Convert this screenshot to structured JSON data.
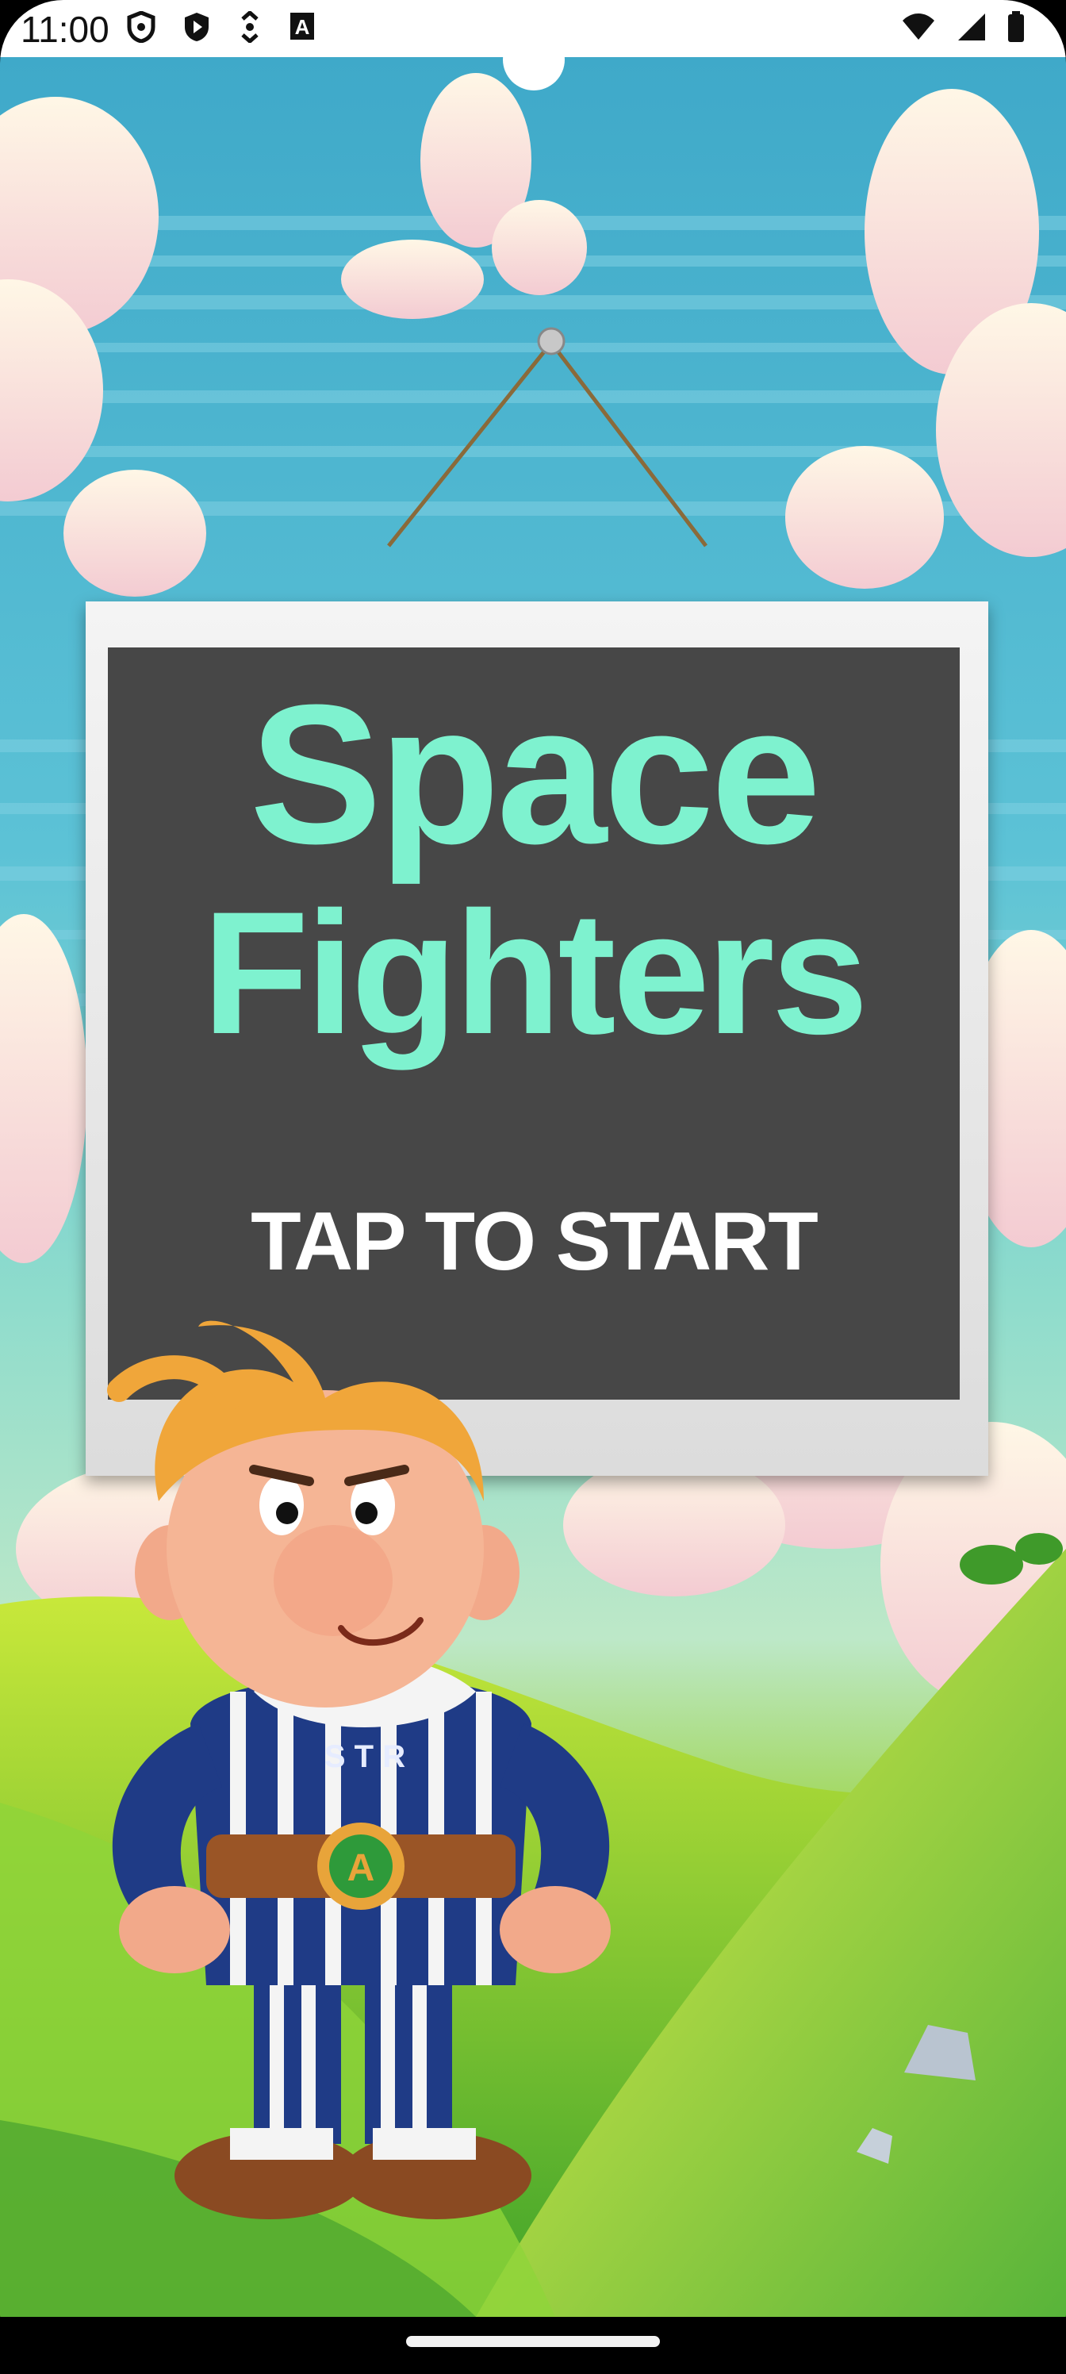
{
  "status_bar": {
    "time": "11:00",
    "left_icons": [
      "shield-icon",
      "play-protect-icon",
      "data-saver-icon",
      "accessibility-a-icon"
    ],
    "right_icons": [
      "wifi-icon",
      "signal-icon",
      "battery-icon"
    ]
  },
  "game": {
    "title_line1": "Space",
    "title_line2": "Fighters",
    "start_prompt": "TAP TO START",
    "shirt_letters": "S T R",
    "belt_letter": "A"
  },
  "colors": {
    "title": "#7ef2cf",
    "board": "#474747",
    "prompt": "#ffffff",
    "sky": "#3fa9c9",
    "grass": "#7fcc3a"
  }
}
